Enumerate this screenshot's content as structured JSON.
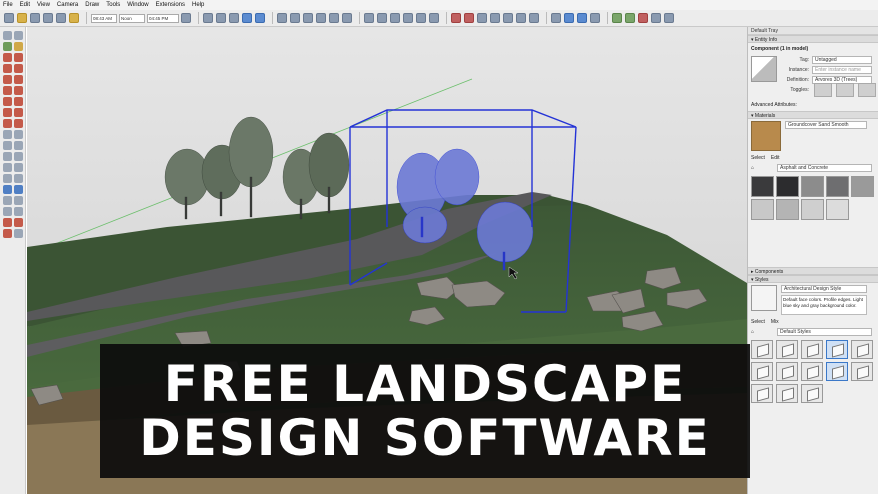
{
  "menu": [
    "File",
    "Edit",
    "View",
    "Camera",
    "Draw",
    "Tools",
    "Window",
    "Extensions",
    "Help"
  ],
  "toolbar": {
    "time_left": "08:43 AM",
    "time_mid": "Noon",
    "time_right": "04:45 PM"
  },
  "tray": {
    "title": "Default Tray",
    "entity_info": {
      "heading": "Entity Info",
      "component": "Component (1 in model)",
      "tag_label": "Tag:",
      "tag_value": "Untagged",
      "instance_label": "Instance:",
      "instance_placeholder": "Enter instance name",
      "definition_label": "Definition:",
      "definition_value": "Árvores 3D (Trees)",
      "toggles_label": "Toggles:",
      "advanced": "Advanced Attributes:"
    },
    "materials": {
      "heading": "Materials",
      "current": "Groundcover Sand Smooth",
      "tab_select": "Select",
      "tab_edit": "Edit",
      "library": "Asphalt and Concrete",
      "swatch_colors": [
        "#3a3a3c",
        "#2c2c2e",
        "#8c8c8c",
        "#6e6e70",
        "#9a9a9a",
        "#c8c8c8",
        "#b4b4b4",
        "#cfcfcf",
        "#dcdcdc"
      ]
    },
    "components": {
      "heading": "Components"
    },
    "styles": {
      "heading": "Styles",
      "current": "Architectural Design Style",
      "description": "Default face colors. Profile edges. Light blue sky and gray background color.",
      "tab_select": "Select",
      "tab_mix": "Mix",
      "library": "Default Styles"
    }
  },
  "banner": {
    "line1": "FREE LANDSCAPE",
    "line2": "DESIGN SOFTWARE"
  },
  "colors": {
    "selection": "#2433d6",
    "grass": "#3f5a38",
    "path": "#5a5a5c",
    "sky": "#dcdcdc"
  }
}
